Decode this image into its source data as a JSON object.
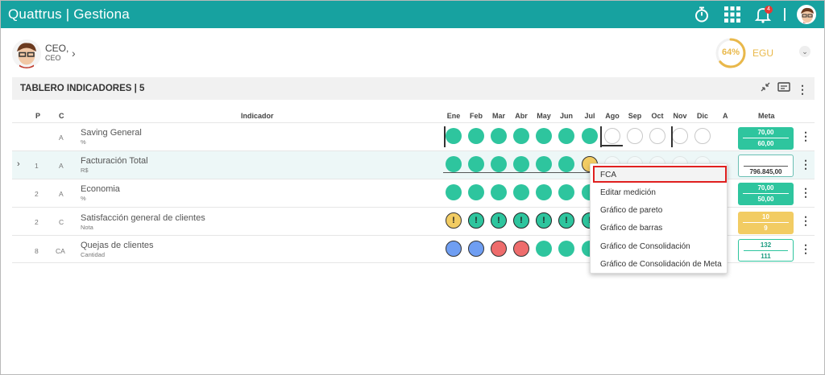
{
  "app": {
    "brand": "Quattrus | Gestiona",
    "notif_count": "4"
  },
  "user": {
    "name": "CEO,",
    "role": "CEO"
  },
  "progress": {
    "value_percent": 64,
    "label": "64%",
    "unit_label": "EGU"
  },
  "board": {
    "title": "TABLERO INDICADORES | 5"
  },
  "columns": {
    "p": "P",
    "c": "C",
    "indicador": "Indicador",
    "months": [
      "Ene",
      "Feb",
      "Mar",
      "Abr",
      "May",
      "Jun",
      "Jul",
      "Ago",
      "Sep",
      "Oct",
      "Nov",
      "Dic"
    ],
    "a": "A",
    "meta": "Meta"
  },
  "rows": [
    {
      "p": "",
      "c": "A",
      "name": "Saving General",
      "unit": "%",
      "meta_top": "70,00",
      "meta_bottom": "60,00"
    },
    {
      "p": "1",
      "c": "A",
      "name": "Facturación Total",
      "unit": "R$",
      "meta_top": "",
      "meta_bottom": "796.845,00"
    },
    {
      "p": "2",
      "c": "A",
      "name": "Economia",
      "unit": "%",
      "meta_top": "70,00",
      "meta_bottom": "50,00"
    },
    {
      "p": "2",
      "c": "C",
      "name": "Satisfacción general de clientes",
      "unit": "Nota",
      "meta_top": "10",
      "meta_bottom": "9"
    },
    {
      "p": "8",
      "c": "CA",
      "name": "Quejas de clientes",
      "unit": "Cantidad",
      "meta_top": "132",
      "meta_bottom": "111"
    }
  ],
  "context_menu": {
    "items": [
      "FCA",
      "Editar medición",
      "Gráfico de pareto",
      "Gráfico de barras",
      "Gráfico de Consolidación",
      "Gráfico de Consolidación de Meta"
    ]
  },
  "colors": {
    "header": "#17a2a0",
    "green": "#2ec59e",
    "yellow": "#f2cc63",
    "red": "#ee6c6c",
    "blue": "#6f9ef2",
    "highlight": "#e0201f"
  }
}
